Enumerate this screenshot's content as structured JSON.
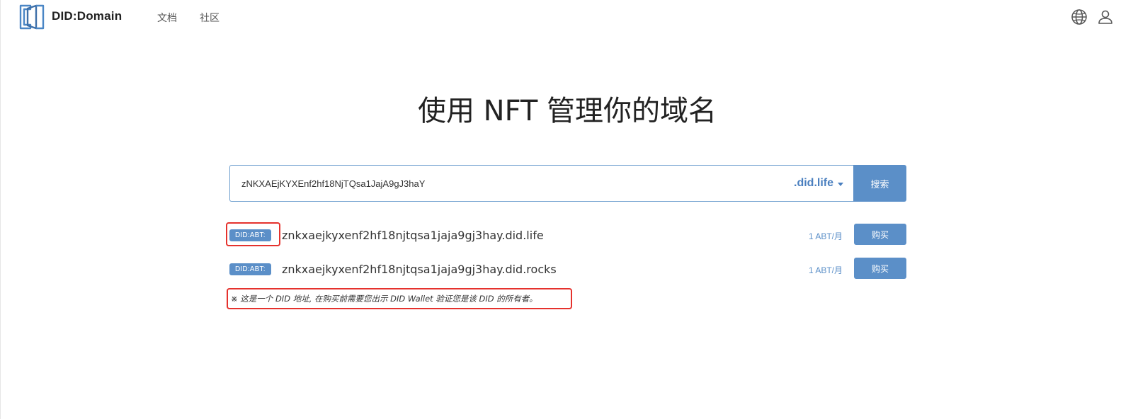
{
  "header": {
    "brand": "DID:Domain",
    "nav": [
      {
        "label": "文档"
      },
      {
        "label": "社区"
      }
    ],
    "icons": [
      "globe-icon",
      "user-icon"
    ]
  },
  "hero": {
    "title": "使用 NFT 管理你的域名"
  },
  "search": {
    "value": "zNKXAEjKYXEnf2hf18NjTQsa1JajA9gJ3haY",
    "tld": ".did.life",
    "button_label": "搜索"
  },
  "results": [
    {
      "badge": "DID:ABT:",
      "domain": "znkxaejkyxenf2hf18njtqsa1jaja9gj3hay.did.life",
      "price": "1 ABT/月",
      "buy_label": "购买"
    },
    {
      "badge": "DID:ABT:",
      "domain": "znkxaejkyxenf2hf18njtqsa1jaja9gj3hay.did.rocks",
      "price": "1 ABT/月",
      "buy_label": "购买"
    }
  ],
  "note": "※ 这是一个 DID 地址, 在购买前需要您出示 DID Wallet 验证您是该 DID 的所有者。",
  "colors": {
    "accent": "#5b8fc8",
    "highlight": "#e5322d"
  }
}
